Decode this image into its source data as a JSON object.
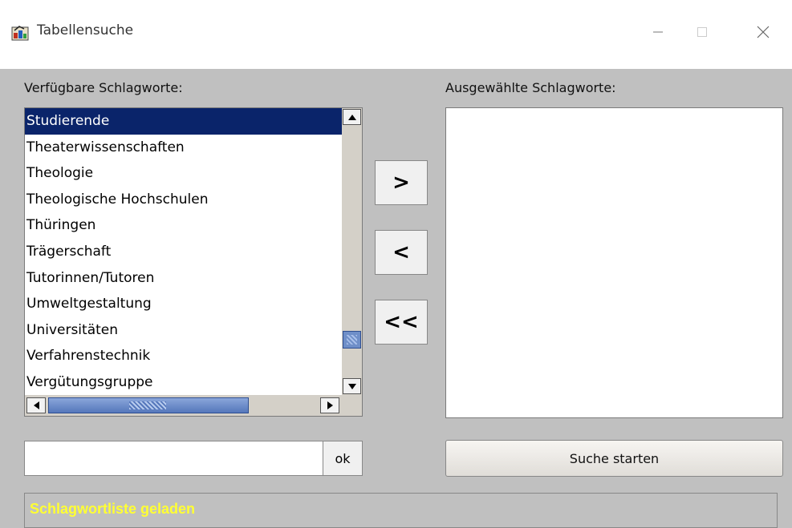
{
  "window": {
    "title": "Tabellensuche"
  },
  "labels": {
    "available": "Verfügbare Schlagworte:",
    "selected": "Ausgewählte Schlagworte:"
  },
  "available_list": {
    "items": [
      {
        "label": "Studierende",
        "selected": true
      },
      {
        "label": "Theaterwissenschaften",
        "selected": false
      },
      {
        "label": "Theologie",
        "selected": false
      },
      {
        "label": "Theologische Hochschulen",
        "selected": false
      },
      {
        "label": "Thüringen",
        "selected": false
      },
      {
        "label": "Trägerschaft",
        "selected": false
      },
      {
        "label": "Tutorinnen/Tutoren",
        "selected": false
      },
      {
        "label": "Umweltgestaltung",
        "selected": false
      },
      {
        "label": "Universitäten",
        "selected": false
      },
      {
        "label": "Verfahrenstechnik",
        "selected": false
      },
      {
        "label": "Vergütungsgruppe",
        "selected": false
      }
    ]
  },
  "buttons": {
    "add": ">",
    "remove": "<",
    "remove_all": "<<",
    "ok": "ok",
    "search": "Suche starten"
  },
  "search_input": {
    "value": "",
    "placeholder": ""
  },
  "status": {
    "text": "Schlagwortliste geladen",
    "color": "#ffff33"
  },
  "colors": {
    "selection_bg": "#0a246a",
    "window_bg": "#c0c0c0"
  }
}
